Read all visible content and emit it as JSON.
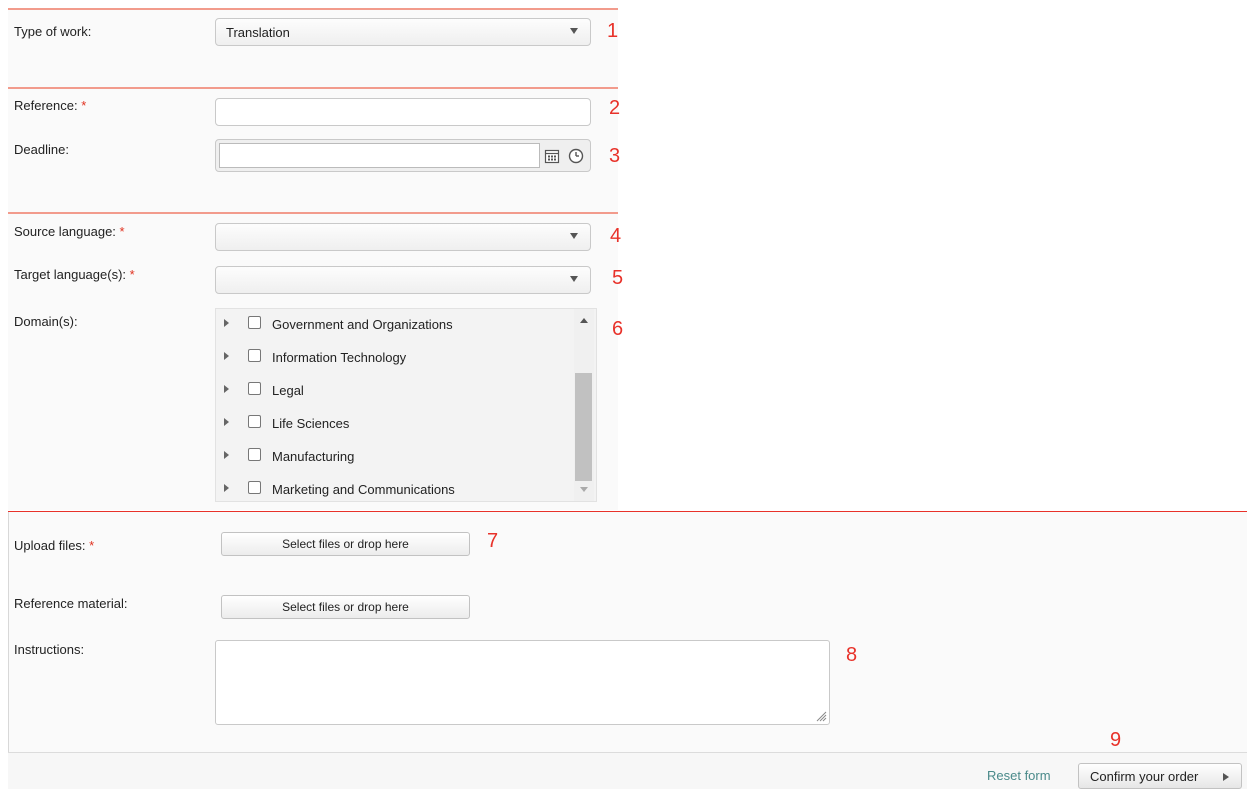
{
  "form": {
    "type_of_work": {
      "label": "Type of work:",
      "value": "Translation",
      "number": "1"
    },
    "reference": {
      "label": "Reference: ",
      "required": "*",
      "value": "",
      "number": "2"
    },
    "deadline": {
      "label": "Deadline:",
      "value": "",
      "number": "3"
    },
    "source_language": {
      "label": "Source language: ",
      "required": "*",
      "value": "",
      "number": "4"
    },
    "target_language": {
      "label": "Target language(s): ",
      "required": "*",
      "value": "",
      "number": "5"
    },
    "domains": {
      "label": "Domain(s):",
      "number": "6",
      "items": [
        "Government and Organizations",
        "Information Technology",
        "Legal",
        "Life Sciences",
        "Manufacturing",
        "Marketing and Communications"
      ]
    },
    "upload_files": {
      "label": "Upload files: ",
      "required": "*",
      "button": "Select files or drop here",
      "number": "7"
    },
    "reference_material": {
      "label": "Reference material:",
      "button": "Select files or drop here"
    },
    "instructions": {
      "label": "Instructions:",
      "value": "",
      "number": "8"
    }
  },
  "footer": {
    "number": "9",
    "reset_label": "Reset form",
    "confirm_label": "Confirm your order"
  },
  "colors": {
    "accent_line": "#f29b8c",
    "annotation": "#e8322a",
    "reset_link": "#4a8a8a"
  },
  "icons": [
    "dropdown-arrow-icon",
    "calendar-icon",
    "clock-icon",
    "expand-triangle-icon",
    "resize-grip-icon",
    "play-arrow-icon"
  ]
}
